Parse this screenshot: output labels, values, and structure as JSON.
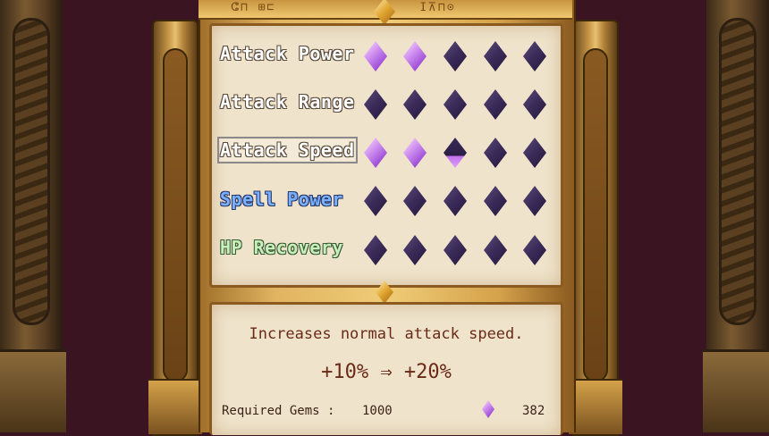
{
  "header": {
    "rune_left": "ⵛ⊓ ⊞⊏",
    "rune_right": "ⵊ⊼⊓⊙"
  },
  "stats": [
    {
      "label": "Attack Power",
      "color": "white",
      "gems": [
        "on",
        "on",
        "off",
        "off",
        "off"
      ]
    },
    {
      "label": "Attack Range",
      "color": "white",
      "gems": [
        "off",
        "off",
        "off",
        "off",
        "off"
      ]
    },
    {
      "label": "Attack Speed",
      "color": "white",
      "selected": true,
      "gems": [
        "on",
        "on",
        "half",
        "off",
        "off"
      ]
    },
    {
      "label": "Spell Power",
      "color": "blue",
      "gems": [
        "off",
        "off",
        "off",
        "off",
        "off"
      ]
    },
    {
      "label": "HP Recovery",
      "color": "green",
      "gems": [
        "off",
        "off",
        "off",
        "off",
        "off"
      ]
    }
  ],
  "detail": {
    "description": "Increases normal attack speed.",
    "change": "+10% ⇒ +20%",
    "required_label": "Required Gems :",
    "required_value": "1000",
    "owned_gem_icon": "purple-gem-icon",
    "owned_value": "382"
  },
  "colors": {
    "gem_on": "#c070e8",
    "gem_off": "#3a2a58",
    "panel_bg": "#efe3cb",
    "frame_gold": "#e0b460",
    "background": "#3a1420"
  }
}
